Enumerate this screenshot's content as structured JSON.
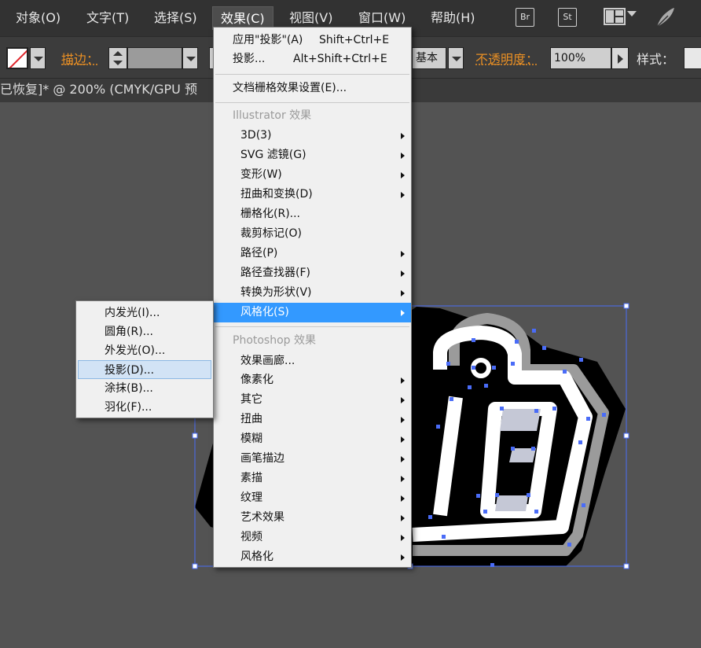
{
  "menubar": {
    "items": [
      {
        "label": "对象(O)"
      },
      {
        "label": "文字(T)"
      },
      {
        "label": "选择(S)"
      },
      {
        "label": "效果(C)",
        "active": true
      },
      {
        "label": "视图(V)"
      },
      {
        "label": "窗口(W)"
      },
      {
        "label": "帮助(H)"
      }
    ],
    "bridge_label": "Br",
    "stock_label": "St"
  },
  "controlbar": {
    "stroke_label": "描边：",
    "stroke_value": "",
    "style_preset": "基本",
    "opacity_label": "不透明度：",
    "opacity_value": "100%",
    "style_label": "样式："
  },
  "document": {
    "tab_title": "已恢复]* @ 200% (CMYK/GPU 预"
  },
  "effect_menu": {
    "apply_last": {
      "label": "应用\"投影\"(A)",
      "shortcut": "Shift+Ctrl+E"
    },
    "last_effect": {
      "label": "投影...",
      "shortcut": "Alt+Shift+Ctrl+E"
    },
    "raster_settings": {
      "label": "文档栅格效果设置(E)..."
    },
    "illustrator_header": "Illustrator 效果",
    "illustrator_items": [
      {
        "label": "3D(3)",
        "submenu": true
      },
      {
        "label": "SVG 滤镜(G)",
        "submenu": true
      },
      {
        "label": "变形(W)",
        "submenu": true
      },
      {
        "label": "扭曲和变换(D)",
        "submenu": true
      },
      {
        "label": "栅格化(R)...",
        "submenu": false
      },
      {
        "label": "裁剪标记(O)",
        "submenu": false
      },
      {
        "label": "路径(P)",
        "submenu": true
      },
      {
        "label": "路径查找器(F)",
        "submenu": true
      },
      {
        "label": "转换为形状(V)",
        "submenu": true
      },
      {
        "label": "风格化(S)",
        "submenu": true,
        "highlighted": true
      }
    ],
    "photoshop_header": "Photoshop 效果",
    "photoshop_items": [
      {
        "label": "效果画廊...",
        "submenu": false
      },
      {
        "label": "像素化",
        "submenu": true
      },
      {
        "label": "其它",
        "submenu": true
      },
      {
        "label": "扭曲",
        "submenu": true
      },
      {
        "label": "模糊",
        "submenu": true
      },
      {
        "label": "画笔描边",
        "submenu": true
      },
      {
        "label": "素描",
        "submenu": true
      },
      {
        "label": "纹理",
        "submenu": true
      },
      {
        "label": "艺术效果",
        "submenu": true
      },
      {
        "label": "视频",
        "submenu": true
      },
      {
        "label": "风格化",
        "submenu": true
      }
    ]
  },
  "stylize_submenu": {
    "items": [
      {
        "label": "内发光(I)..."
      },
      {
        "label": "圆角(R)..."
      },
      {
        "label": "外发光(O)..."
      },
      {
        "label": "投影(D)...",
        "hovered": true
      },
      {
        "label": "涂抹(B)..."
      },
      {
        "label": "羽化(F)..."
      }
    ]
  },
  "colors": {
    "menubar_bg": "#323232",
    "canvas_bg": "#535353",
    "menu_bg": "#f0f0f0",
    "highlight": "#3399ff",
    "submenu_hover": "#d2e3f5",
    "selection": "#4a6cf7",
    "label_orange": "#e98f24"
  }
}
